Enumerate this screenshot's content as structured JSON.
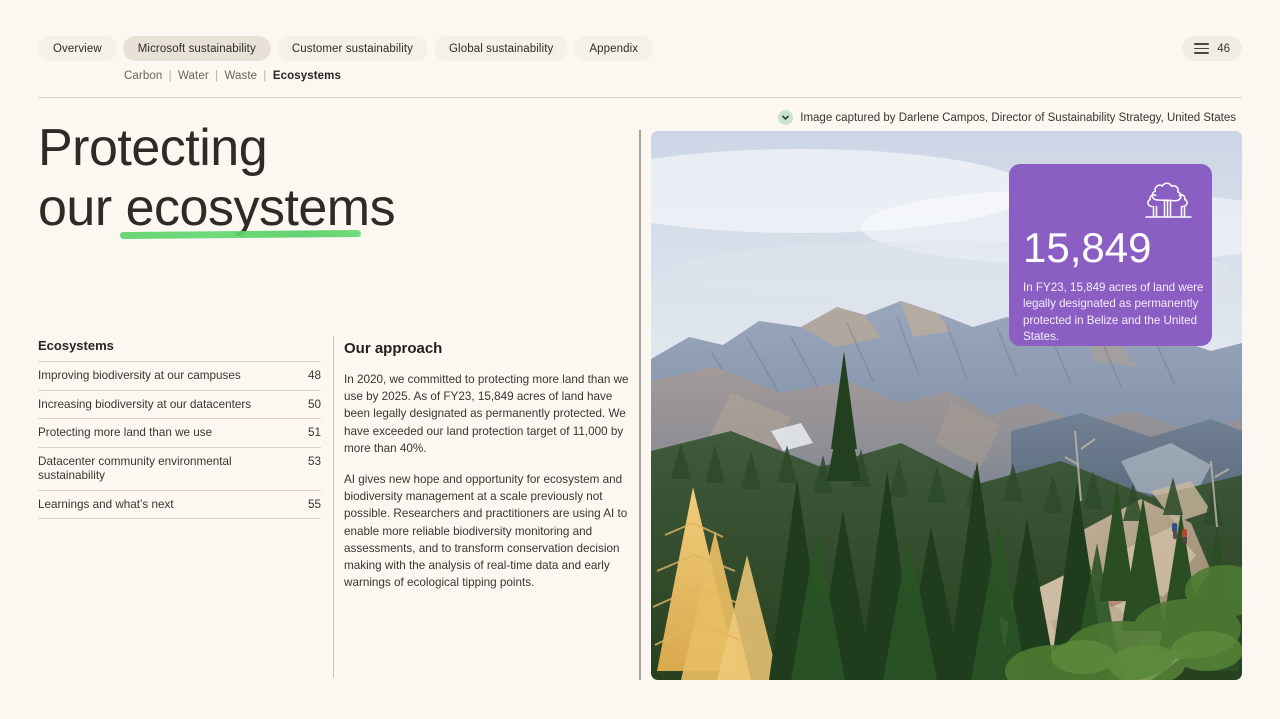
{
  "nav": {
    "tabs": [
      {
        "label": "Overview",
        "active": false
      },
      {
        "label": "Microsoft sustainability",
        "active": true
      },
      {
        "label": "Customer sustainability",
        "active": false
      },
      {
        "label": "Global sustainability",
        "active": false
      },
      {
        "label": "Appendix",
        "active": false
      }
    ],
    "page_badge": {
      "icon": "hamburger-menu-icon",
      "page_number": "46"
    },
    "breadcrumb": {
      "items": [
        "Carbon",
        "Water",
        "Waste",
        "Ecosystems"
      ],
      "active": "Ecosystems",
      "separator": "|"
    }
  },
  "title": {
    "line1": "Protecting",
    "line2": "our ecosystems",
    "underline_color": "#5ED26C"
  },
  "toc": {
    "heading": "Ecosystems",
    "rows": [
      {
        "label": "Improving biodiversity at our campuses",
        "page": "48"
      },
      {
        "label": "Increasing biodiversity at our datacenters",
        "page": "50"
      },
      {
        "label": "Protecting more land than we use",
        "page": "51"
      },
      {
        "label": "Datacenter community environmental sustainability",
        "page": "53"
      },
      {
        "label": "Learnings and what’s next",
        "page": "55"
      }
    ]
  },
  "approach": {
    "heading": "Our approach",
    "paragraphs": [
      "In 2020, we committed to protecting more land than we use by 2025. As of FY23, 15,849 acres of land have been legally designated as permanently protected. We have exceeded our land protection target of 11,000 by more than 40%.",
      "AI gives new hope and opportunity for ecosystem and biodiversity management at a scale previously not possible. Researchers and practitioners are using AI to enable more reliable biodiversity monitoring and assessments, and to transform conservation decision making with the analysis of real-time data and early warnings of ecological tipping points."
    ]
  },
  "photo": {
    "caption": "Image captured by Darlene Campos, Director of Sustainability Strategy, United States",
    "caption_icon": "chevron-down-circle-icon",
    "alt": "Mountain ridge landscape with conifer forest, golden larch trees, rocky outcrops and hikers on a trail"
  },
  "stat_card": {
    "icon": "trees-icon",
    "value": "15,849",
    "body": "In FY23, 15,849 acres of land were legally designated as permanently protected in Belize and the United States.",
    "background_color": "#8B5EC4"
  }
}
